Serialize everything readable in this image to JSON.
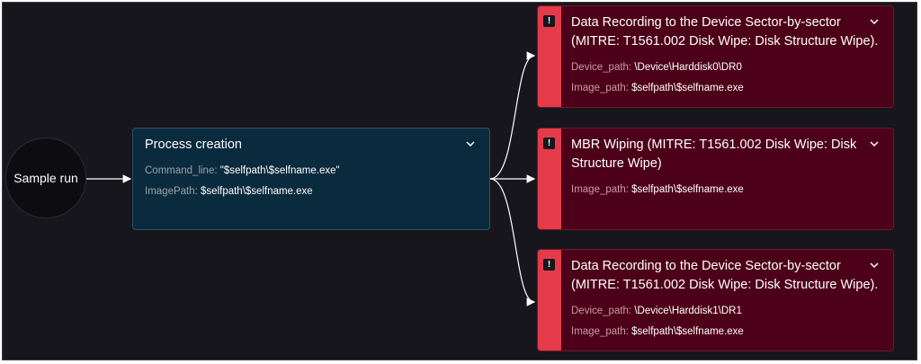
{
  "start": {
    "label": "Sample run"
  },
  "process": {
    "title": "Process creation",
    "fields": [
      {
        "key": "Command_line:",
        "value": "\"$selfpath\\$selfname.exe\""
      },
      {
        "key": "ImagePath:",
        "value": "$selfpath\\$selfname.exe"
      }
    ]
  },
  "alerts": [
    {
      "title_lines": [
        "Data Recording to the Device Sector-by-sector",
        "(MITRE: T1561.002 Disk Wipe: Disk Structure Wipe)."
      ],
      "fields": [
        {
          "key": "Device_path:",
          "value": "\\Device\\Harddisk0\\DR0"
        },
        {
          "key": "Image_path:",
          "value": "$selfpath\\$selfname.exe"
        }
      ]
    },
    {
      "title_lines": [
        "MBR Wiping (MITRE: T1561.002 Disk Wipe: Disk",
        "Structure Wipe)"
      ],
      "fields": [
        {
          "key": "Image_path:",
          "value": "$selfpath\\$selfname.exe"
        }
      ]
    },
    {
      "title_lines": [
        "Data Recording to the Device Sector-by-sector",
        "(MITRE: T1561.002 Disk Wipe: Disk Structure Wipe)."
      ],
      "fields": [
        {
          "key": "Device_path:",
          "value": "\\Device\\Harddisk1\\DR1"
        },
        {
          "key": "Image_path:",
          "value": "$selfpath\\$selfname.exe"
        }
      ]
    }
  ],
  "icons": {
    "expand": "chevron-down-icon",
    "alert": "exclamation-icon"
  },
  "colors": {
    "background": "#16161c",
    "process_card": "#0a2a3d",
    "alert_card": "#4d0019",
    "alert_strip": "#e43b4a",
    "connector": "#ffffff"
  }
}
